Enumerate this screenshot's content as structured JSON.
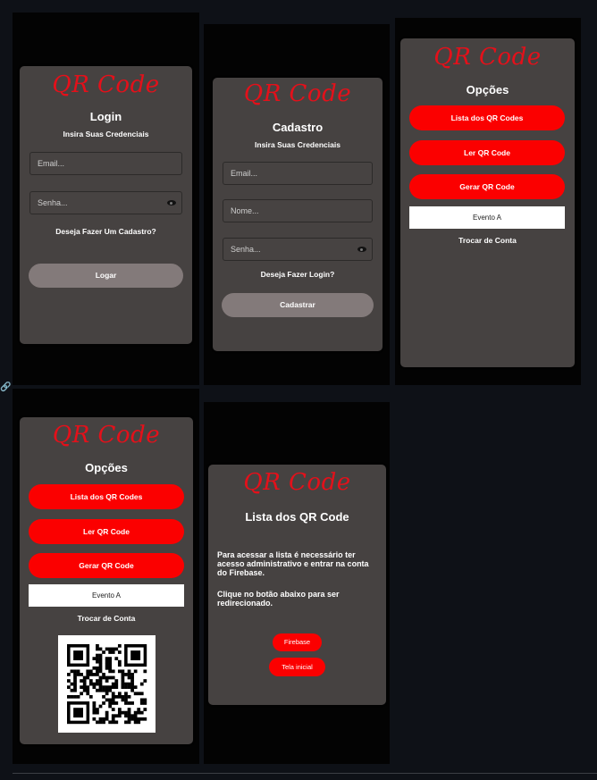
{
  "logo": "QR Code",
  "login": {
    "title": "Login",
    "subtitle": "Insira Suas Credenciais",
    "email_placeholder": "Email...",
    "password_placeholder": "Senha...",
    "register_link": "Deseja Fazer Um Cadastro?",
    "submit": "Logar"
  },
  "register": {
    "title": "Cadastro",
    "subtitle": "Insira Suas Credenciais",
    "email_placeholder": "Email...",
    "name_placeholder": "Nome...",
    "password_placeholder": "Senha...",
    "login_link": "Deseja Fazer Login?",
    "submit": "Cadastrar"
  },
  "options": {
    "title": "Opções",
    "list_button": "Lista dos QR Codes",
    "read_button": "Ler QR Code",
    "generate_button": "Gerar QR Code",
    "event_select": "Evento A",
    "switch_account": "Trocar de Conta"
  },
  "list": {
    "title": "Lista dos QR Code",
    "paragraph1": "Para acessar a lista é necessário ter acesso administrativo e entrar na conta do Firebase.",
    "paragraph2": "Clique no botão abaixo para ser redirecionado.",
    "firebase_button": "Firebase",
    "home_button": "Tela inicial"
  },
  "colors": {
    "accent": "#fb0000",
    "logo": "#e4101a",
    "card": "#464241",
    "phone_bg": "#030303",
    "page_bg": "#0e1117",
    "disabled_button": "#837a7a"
  }
}
